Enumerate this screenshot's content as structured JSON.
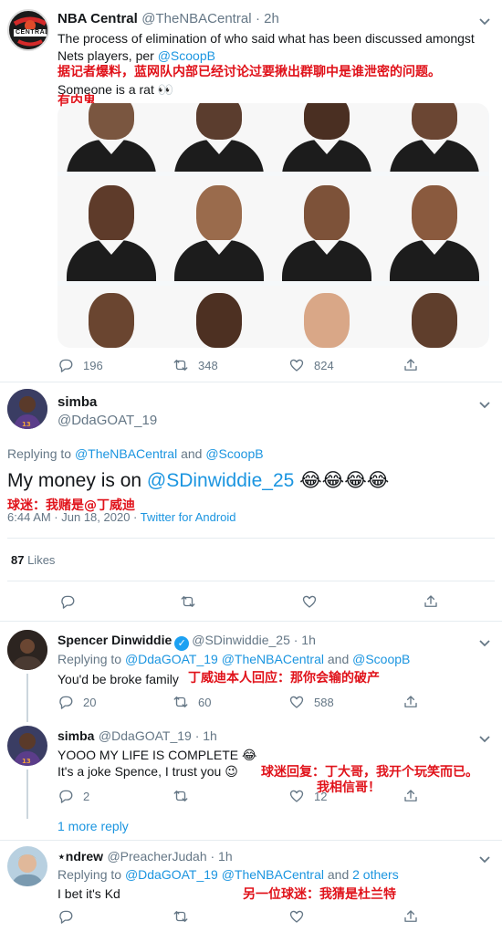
{
  "tweet1": {
    "name": "NBA Central",
    "handle": "@TheNBACentral",
    "time": "· 2h",
    "text_line1": "The process of elimination of who said what has been discussed amongst",
    "text_line2_prefix": "Nets players, per ",
    "text_line2_link": "@ScoopB",
    "overlay_cn1": "据记者爆料，蓝网队内部已经讨论过要揪出群聊中是谁泄密的问题。",
    "text_line3": "Someone is a rat 👀",
    "overlay_cn2": "有内鬼",
    "avatar_text": "CENTRAL",
    "reply_count": "196",
    "retweet_count": "348",
    "like_count": "824"
  },
  "main_tweet": {
    "name": "simba",
    "handle": "@DdaGOAT_19",
    "replying_prefix": "Replying to ",
    "replying_user1": "@TheNBACentral",
    "replying_and": " and ",
    "replying_user2": "@ScoopB",
    "text_prefix": "My money is on ",
    "text_link": "@SDinwiddie_25",
    "text_emoji": " 😂😂😂😂",
    "overlay_cn": "球迷：我赌是@丁威迪",
    "timestamp": "6:44 AM · Jun 18, 2020 · ",
    "client": "Twitter for Android",
    "likes_count": "87",
    "likes_label": " Likes"
  },
  "reply1": {
    "name": "Spencer Dinwiddie",
    "handle": "@SDinwiddie_25 · 1h",
    "replying_prefix": "Replying to ",
    "replying_user1": "@DdaGOAT_19",
    "replying_user2": "@TheNBACentral",
    "replying_and": " and ",
    "replying_user3": "@ScoopB",
    "text": "You'd be broke family",
    "overlay_cn": "丁威迪本人回应：那你会输的破产",
    "reply_count": "20",
    "retweet_count": "60",
    "like_count": "588"
  },
  "reply2": {
    "name": "simba",
    "handle": "@DdaGOAT_19 · 1h",
    "text_line1": "YOOO MY LIFE IS COMPLETE 😂",
    "text_line2": "It's a joke Spence, I trust you 😉",
    "overlay_cn1": "球迷回复：丁大哥，我开个玩笑而已。",
    "overlay_cn2": "我相信哥！",
    "reply_count": "2",
    "like_count": "12"
  },
  "more_replies": "1 more reply",
  "reply3": {
    "name": "⋆ndrew",
    "handle": "@PreacherJudah · 1h",
    "replying_prefix": "Replying to ",
    "replying_user1": "@DdaGOAT_19",
    "replying_user2": "@TheNBACentral",
    "replying_and": " and ",
    "replying_others": "2 others",
    "text": "I bet it's Kd",
    "overlay_cn": "另一位球迷：我猜是杜兰特"
  },
  "colors": {
    "link": "#1b95e0",
    "secondary": "#657786",
    "overlay_red": "#e0121a",
    "verified": "#1da1f2"
  },
  "icons": [
    "reply-icon",
    "retweet-icon",
    "like-icon",
    "share-icon",
    "chevron-down-icon",
    "verified-badge-icon"
  ]
}
